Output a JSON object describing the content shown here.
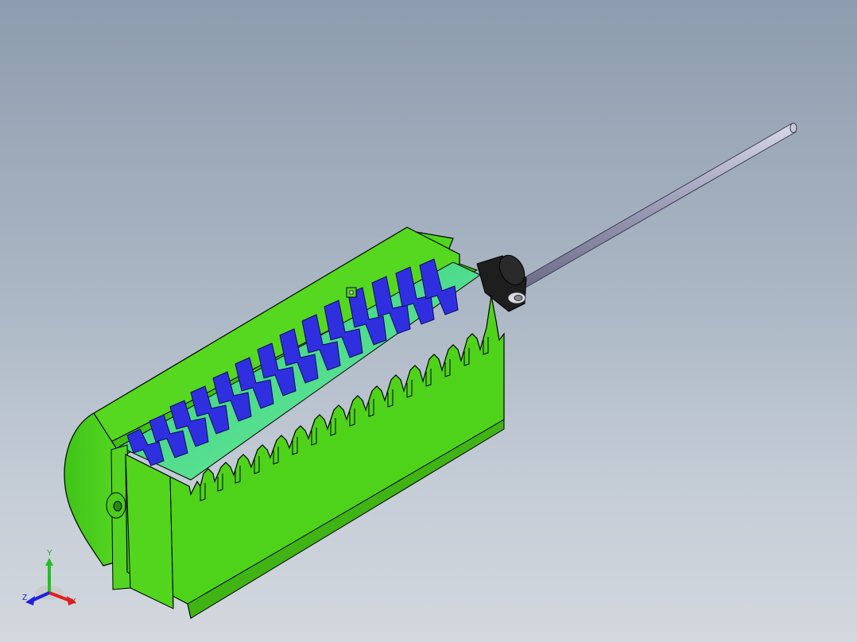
{
  "viewport": {
    "background_top": "#8d9cae",
    "background_bottom": "#d3d8de"
  },
  "model": {
    "housing_color": "#4fd31a",
    "housing_inner_color": "#22c86a",
    "blade_color": "#3030e0",
    "shaft_color": "#a8a8c0",
    "motor_color": "#2a2a2a"
  },
  "triad": {
    "x_label": "X",
    "y_label": "Y",
    "z_label": "Z",
    "x_color": "#e02020",
    "y_color": "#20c020",
    "z_color": "#2020e0"
  }
}
